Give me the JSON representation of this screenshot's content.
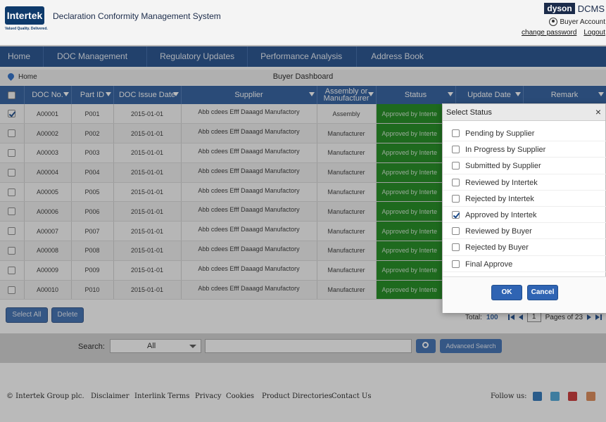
{
  "header": {
    "logo_text": "Intertek",
    "logo_tagline": "Valued Quality. Delivered.",
    "app_title": "Declaration Conformity Management System",
    "brand_logo": "dyson",
    "brand_product": "DCMS",
    "account_label": "Buyer Account",
    "change_password": "change password",
    "logout": "Logout"
  },
  "nav": {
    "items": [
      "Home",
      "DOC Management",
      "Regulatory Updates",
      "Performance Analysis",
      "Address Book"
    ]
  },
  "breadcrumb": {
    "home": "Home",
    "page_title": "Buyer Dashboard"
  },
  "table": {
    "columns": [
      "DOC No.",
      "Part ID",
      "DOC Issue Date",
      "Supplier",
      "Assembly or Manufacturer",
      "Status",
      "Update Date",
      "Remark"
    ],
    "rows": [
      {
        "doc": "A00001",
        "part": "P001",
        "date": "2015-01-01",
        "supplier": "Abb cdees Efff Daaagd Manufactory",
        "type": "Assembly",
        "status": "Approved by Interte",
        "checked": true
      },
      {
        "doc": "A00002",
        "part": "P002",
        "date": "2015-01-01",
        "supplier": "Abb cdees Efff Daaagd Manufactory",
        "type": "Manufacturer",
        "status": "Approved by Interte",
        "checked": false
      },
      {
        "doc": "A00003",
        "part": "P003",
        "date": "2015-01-01",
        "supplier": "Abb cdees Efff Daaagd Manufactory",
        "type": "Manufacturer",
        "status": "Approved by Interte",
        "checked": false
      },
      {
        "doc": "A00004",
        "part": "P004",
        "date": "2015-01-01",
        "supplier": "Abb cdees Efff Daaagd Manufactory",
        "type": "Manufacturer",
        "status": "Approved by Interte",
        "checked": false
      },
      {
        "doc": "A00005",
        "part": "P005",
        "date": "2015-01-01",
        "supplier": "Abb cdees Efff Daaagd Manufactory",
        "type": "Manufacturer",
        "status": "Approved by Interte",
        "checked": false
      },
      {
        "doc": "A00006",
        "part": "P006",
        "date": "2015-01-01",
        "supplier": "Abb cdees Efff Daaagd Manufactory",
        "type": "Manufacturer",
        "status": "Approved by Interte",
        "checked": false
      },
      {
        "doc": "A00007",
        "part": "P007",
        "date": "2015-01-01",
        "supplier": "Abb cdees Efff Daaagd Manufactory",
        "type": "Manufacturer",
        "status": "Approved by Interte",
        "checked": false
      },
      {
        "doc": "A00008",
        "part": "P008",
        "date": "2015-01-01",
        "supplier": "Abb cdees Efff Daaagd Manufactory",
        "type": "Manufacturer",
        "status": "Approved by Interte",
        "checked": false
      },
      {
        "doc": "A00009",
        "part": "P009",
        "date": "2015-01-01",
        "supplier": "Abb cdees Efff Daaagd Manufactory",
        "type": "Manufacturer",
        "status": "Approved by Interte",
        "checked": false
      },
      {
        "doc": "A00010",
        "part": "P010",
        "date": "2015-01-01",
        "supplier": "Abb cdees Efff Daaagd Manufactory",
        "type": "Manufacturer",
        "status": "Approved by Interte",
        "checked": false
      }
    ]
  },
  "actions": {
    "select_all": "Select All",
    "delete": "Delete"
  },
  "pager": {
    "total_label": "Total:",
    "total": "100",
    "current_page": "1",
    "pages_label": "Pages of 23"
  },
  "search": {
    "label": "Search:",
    "scope": "All",
    "query": "",
    "advanced": "Advanced Search"
  },
  "footer": {
    "copyright": "© Intertek Group plc.",
    "links": [
      "Disclaimer",
      "Interlink Terms",
      "Privacy",
      "Cookies",
      "Product Directories",
      "Contact Us"
    ],
    "follow": "Follow us:"
  },
  "dialog": {
    "title": "Select Status",
    "close": "×",
    "options": [
      {
        "label": "Pending by Supplier",
        "checked": false
      },
      {
        "label": "In Progress by Supplier",
        "checked": false
      },
      {
        "label": "Submitted by Supplier",
        "checked": false
      },
      {
        "label": "Reviewed by Intertek",
        "checked": false
      },
      {
        "label": "Rejected by Intertek",
        "checked": false
      },
      {
        "label": "Approved by Intertek",
        "checked": true
      },
      {
        "label": "Reviewed by Buyer",
        "checked": false
      },
      {
        "label": "Rejected by Buyer",
        "checked": false
      },
      {
        "label": "Final Approve",
        "checked": false
      }
    ],
    "ok": "OK",
    "cancel": "Cancel"
  },
  "colors": {
    "nav": "#1f4d8c",
    "status_green": "#1a8a1a",
    "button": "#3b6db2"
  }
}
